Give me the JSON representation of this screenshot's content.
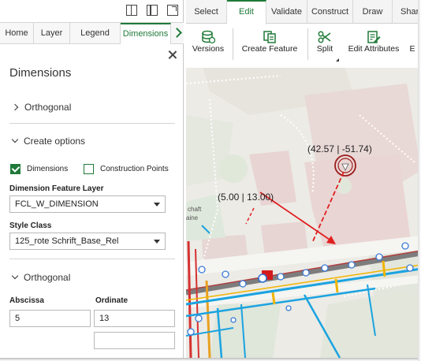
{
  "panel": {
    "tabs": [
      "Home",
      "Layer",
      "Legend",
      "Dimensions"
    ],
    "title": "Dimensions",
    "section_orthogonal_top": "Orthogonal",
    "section_create_options": "Create options",
    "checkbox_dimensions": {
      "label": "Dimensions",
      "checked": true
    },
    "checkbox_construction_points": {
      "label": "Construction Points",
      "checked": false
    },
    "dimension_feature_layer": {
      "label": "Dimension Feature Layer",
      "value": "FCL_W_DIMENSION"
    },
    "style_class": {
      "label": "Style Class",
      "value": "125_rote Schrift_Base_Rel"
    },
    "section_orthogonal": "Orthogonal",
    "abscissa": {
      "label": "Abscissa",
      "value": "5"
    },
    "ordinate": {
      "label": "Ordinate",
      "value": "13"
    }
  },
  "ribbon": {
    "tabs": [
      "Select",
      "Edit",
      "Validate",
      "Construct",
      "Draw",
      "Shar"
    ],
    "buttons": [
      "Versions",
      "Create Feature",
      "Split",
      "Edit Attributes",
      "E"
    ]
  },
  "map": {
    "point_a_label": "(42.57 | -51.74)",
    "point_b_label": "(5.00 | 13.00)",
    "street_label_1": "chaft",
    "street_label_2": "aine"
  },
  "colors": {
    "accent": "#1f7a39",
    "dimension_red": "#e02020",
    "pipe_blue": "#1aa3e0"
  }
}
